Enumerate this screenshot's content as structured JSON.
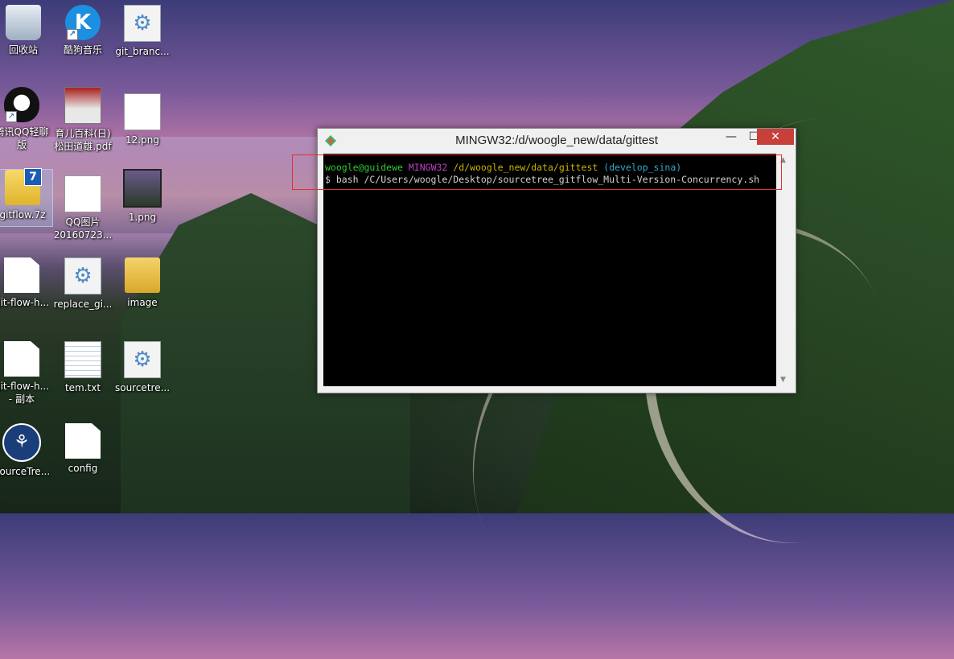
{
  "desktop": {
    "icons": [
      {
        "label": "回收站"
      },
      {
        "label": "酷狗音乐"
      },
      {
        "label": "git_branc..."
      },
      {
        "label": "腾讯QQ轻聊",
        "label2": "版"
      },
      {
        "label": "育儿百科(日)",
        "label2": "松田道雄.pdf"
      },
      {
        "label": "12.png"
      },
      {
        "label": "gitflow.7z"
      },
      {
        "label": "QQ图片",
        "label2": "20160723..."
      },
      {
        "label": "1.png"
      },
      {
        "label": "git-flow-h..."
      },
      {
        "label": "replace_gi..."
      },
      {
        "label": "image"
      },
      {
        "label": "git-flow-h...",
        "label2": "- 副本"
      },
      {
        "label": "tem.txt"
      },
      {
        "label": "sourcetre..."
      },
      {
        "label": "SourceTre..."
      },
      {
        "label": "config"
      }
    ]
  },
  "window": {
    "title": "MINGW32:/d/woogle_new/data/gittest",
    "buttons": {
      "minimize": "—",
      "maximize": "☐",
      "close": "✕"
    }
  },
  "terminal": {
    "prompt_user": "woogle@guidewe",
    "prompt_env": "MINGW32",
    "prompt_path": "/d/woogle_new/data/gittest",
    "prompt_branch": "(develop_sina)",
    "command": "$ bash /C/Users/woogle/Desktop/sourcetree_gitflow_Multi-Version-Concurrency.sh"
  },
  "colors": {
    "close_button": "#c7413a",
    "highlight_box": "#e03030"
  }
}
